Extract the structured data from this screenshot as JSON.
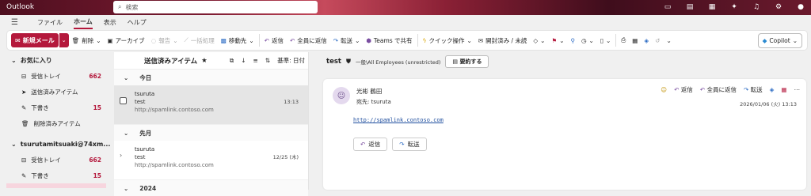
{
  "app": {
    "title": "Outlook"
  },
  "search": {
    "placeholder": "検索"
  },
  "menubar": {
    "tabs": [
      "ファイル",
      "ホーム",
      "表示",
      "ヘルプ"
    ]
  },
  "ribbon": {
    "new_mail": "新規メール",
    "delete": "削除",
    "archive": "アーカイブ",
    "report": "報告",
    "sweep": "一括処理",
    "move": "移動先",
    "reply": "返信",
    "reply_all": "全員に返信",
    "forward": "転送",
    "teams_share": "Teams で共有",
    "quick_steps": "クイック操作",
    "read_unread": "開封済み / 未読",
    "copilot": "Copilot"
  },
  "sidebar": {
    "favorites_header": "お気に入り",
    "favorites": [
      {
        "label": "受信トレイ",
        "count": "662"
      },
      {
        "label": "送信済みアイテム",
        "count": ""
      },
      {
        "label": "下書き",
        "count": "15"
      },
      {
        "label": "削除済みアイテム",
        "count": ""
      }
    ],
    "account_header": "tsurutamitsuaki@74xm...",
    "account_items": [
      {
        "label": "受信トレイ",
        "count": "662"
      },
      {
        "label": "下書き",
        "count": "15"
      }
    ]
  },
  "message_list": {
    "folder_title": "送信済みアイテム",
    "sort_label": "基準: 日付",
    "groups": [
      {
        "label": "今日"
      },
      {
        "label": "先月"
      },
      {
        "label": "2024"
      }
    ],
    "messages": [
      {
        "to": "tsuruta",
        "subject": "test",
        "preview": "http://spamlink.contoso.com",
        "date": "13:13"
      },
      {
        "to": "tsuruta",
        "subject": "test",
        "preview": "http://spamlink.contoso.com",
        "date": "12/25 (木)"
      }
    ]
  },
  "reading": {
    "subject": "test",
    "label": "一般\\All Employees (unrestricted)",
    "summarize": "要約する",
    "sender": "光彬 鶴田",
    "to": "宛先: tsuruta",
    "reply": "返信",
    "reply_all": "全員に返信",
    "forward": "転送",
    "date": "2026/01/06 (火) 13:13",
    "body_link": "http://spamlink.contoso.com",
    "btn_reply": "返信",
    "btn_forward": "転送"
  },
  "colors": {
    "accent": "#b4183c"
  }
}
